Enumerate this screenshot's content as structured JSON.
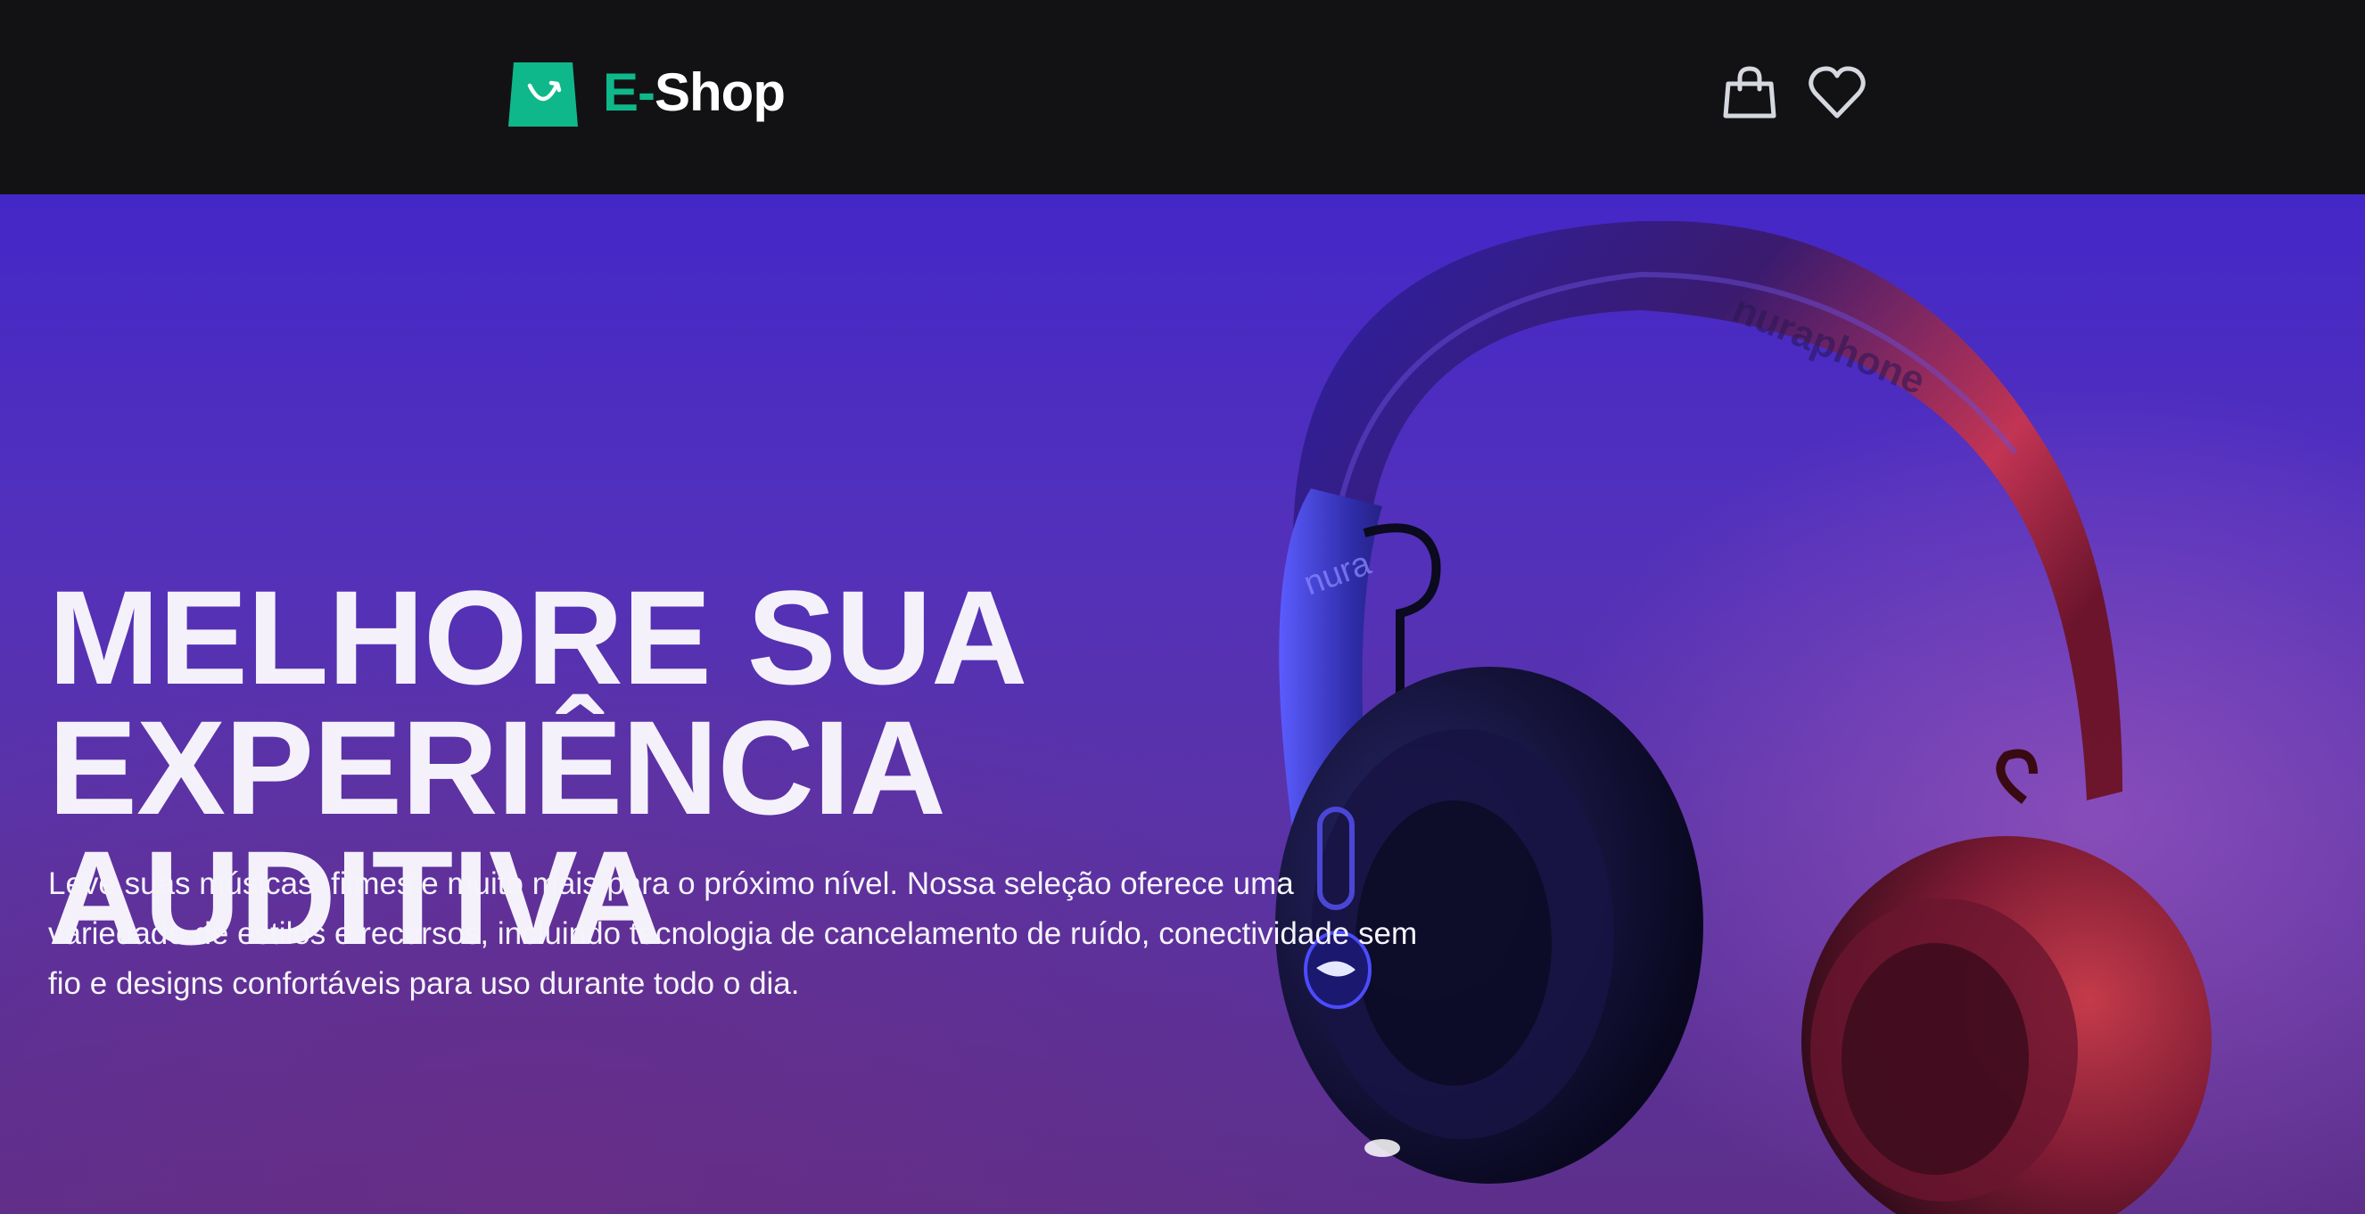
{
  "header": {
    "logo": {
      "accent": "E-",
      "text": "Shop",
      "icon": "shopping-bag-logo-icon",
      "accent_color": "#0fb88a"
    },
    "actions": [
      {
        "icon": "shopping-bag-icon"
      },
      {
        "icon": "heart-icon"
      }
    ]
  },
  "hero": {
    "title_line1": "MELHORE SUA EXPERIÊNCIA",
    "title_line2": "AUDITIVA",
    "description": "Leve suas músicas, filmes e muito mais para o próximo nível. Nossa seleção oferece uma variedade de estilos e recursos, incluindo tecnologia de cancelamento de ruído, conectividade sem fio e designs confortáveis para uso durante todo o dia.",
    "image": {
      "alt": "headphones-image",
      "brand_headband": "nuraphone",
      "brand_yoke": "nura"
    }
  },
  "colors": {
    "header_bg": "#121214",
    "brand_green": "#0fb88a",
    "hero_top": "#4427c7",
    "hero_bottom": "#5d2f8a"
  }
}
